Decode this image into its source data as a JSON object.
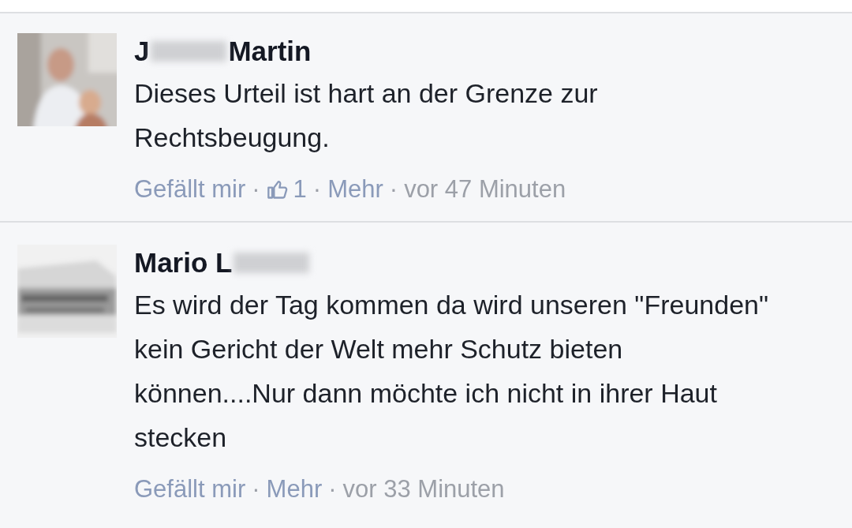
{
  "comments": [
    {
      "name_start": "J",
      "name_redacted": true,
      "name_end": "Martin",
      "text": "Dieses Urteil ist hart an der Grenze zur Rechtsbeugung.",
      "meta": [
        {
          "kind": "link",
          "text": "Gefällt mir"
        },
        {
          "kind": "sep",
          "text": "·"
        },
        {
          "kind": "likes",
          "text": "1"
        },
        {
          "kind": "sep",
          "text": "·"
        },
        {
          "kind": "link",
          "text": "Mehr"
        },
        {
          "kind": "sep",
          "text": "·"
        },
        {
          "kind": "time",
          "text": "vor 47 Minuten"
        }
      ]
    },
    {
      "name_start": "Mario L",
      "name_redacted": true,
      "text": "Es wird der Tag kommen da wird unseren \"Freunden\" kein Gericht der Welt mehr Schutz bieten können....Nur dann möchte ich nicht in ihrer Haut stecken",
      "meta": [
        {
          "kind": "link",
          "text": "Gefällt mir"
        },
        {
          "kind": "sep",
          "text": "·"
        },
        {
          "kind": "link",
          "text": "Mehr"
        },
        {
          "kind": "sep",
          "text": "·"
        },
        {
          "kind": "time",
          "text": "vor 33 Minuten"
        }
      ]
    }
  ]
}
